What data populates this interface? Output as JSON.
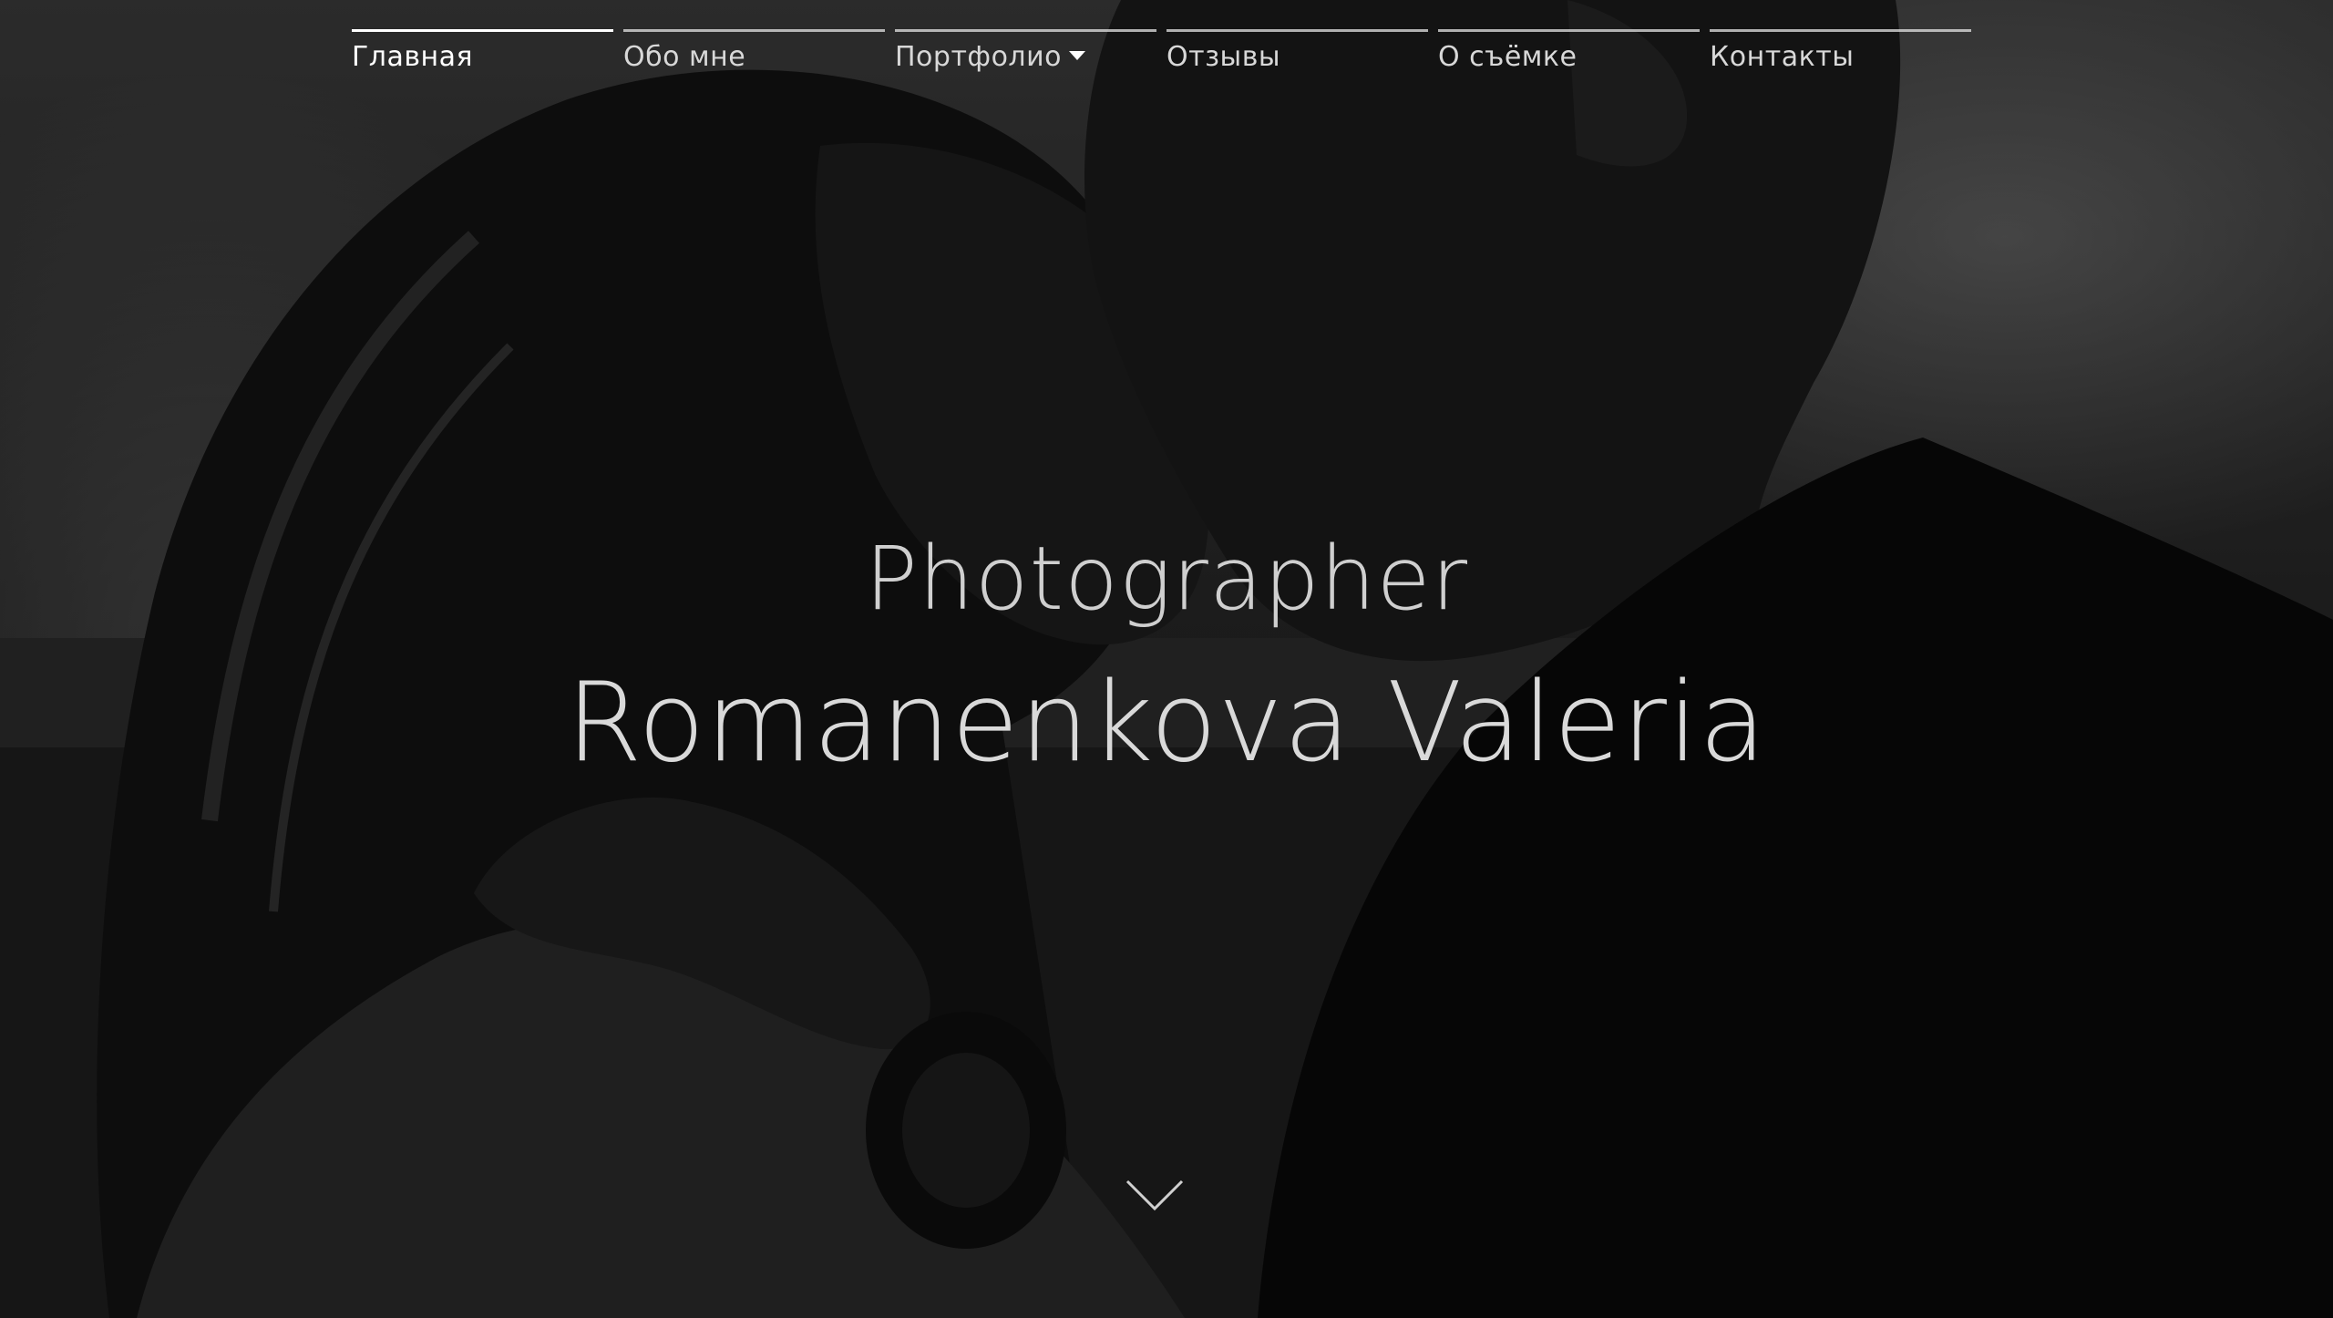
{
  "nav": {
    "items": [
      {
        "label": "Главная",
        "active": true
      },
      {
        "label": "Обо мне"
      },
      {
        "label": "Портфолио",
        "has_dropdown": true
      },
      {
        "label": "Отзывы"
      },
      {
        "label": "О съёмке"
      },
      {
        "label": "Контакты"
      }
    ]
  },
  "hero": {
    "subtitle": "Photographer",
    "name": "Romanenkova Valeria",
    "scroll_icon": "chevron-down-icon",
    "background": "black-and-white couple photo"
  },
  "colors": {
    "text": "#e6e6e6",
    "nav_line": "#ffffff",
    "overlay": "#000000"
  }
}
